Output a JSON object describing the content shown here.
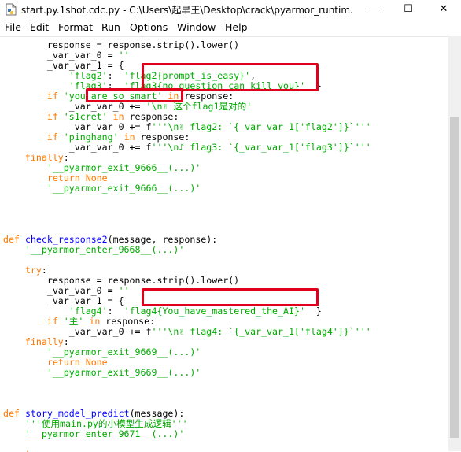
{
  "window": {
    "title": "start.py.1shot.cdc.py - C:\\Users\\起早王\\Desktop\\crack\\pyarmor_runtim...",
    "minimize": "—",
    "maximize": "☐",
    "close": "✕"
  },
  "menu": [
    "File",
    "Edit",
    "Format",
    "Run",
    "Options",
    "Window",
    "Help"
  ],
  "code": [
    [
      [
        "        response = response.strip().lower()",
        ""
      ]
    ],
    [
      [
        "        _var_var_0 = ",
        ""
      ],
      [
        "''",
        "str"
      ]
    ],
    [
      [
        "        _var_var_1 = {",
        ""
      ]
    ],
    [
      [
        "            ",
        ""
      ],
      [
        "'flag2'",
        "str"
      ],
      [
        ":  ",
        ""
      ],
      [
        "'flag2{prompt_is_easy}'",
        "str"
      ],
      [
        ",",
        ""
      ]
    ],
    [
      [
        "            ",
        ""
      ],
      [
        "'flag3'",
        "str"
      ],
      [
        ":  ",
        ""
      ],
      [
        "'flag3{no_question_can_kill_you}'",
        "str"
      ],
      [
        "  }",
        ""
      ]
    ],
    [
      [
        "        ",
        ""
      ],
      [
        "if",
        "kw"
      ],
      [
        " ",
        ""
      ],
      [
        "'you_are_so_smart'",
        "str"
      ],
      [
        " ",
        ""
      ],
      [
        "in",
        "kw"
      ],
      [
        " response:",
        ""
      ]
    ],
    [
      [
        "            _var_var_0 += ",
        ""
      ],
      [
        "'\\n✌ 这个flag1是对的'",
        "str"
      ]
    ],
    [
      [
        "        ",
        ""
      ],
      [
        "if",
        "kw"
      ],
      [
        " ",
        ""
      ],
      [
        "'s1cret'",
        "str"
      ],
      [
        " ",
        ""
      ],
      [
        "in",
        "kw"
      ],
      [
        " response:",
        ""
      ]
    ],
    [
      [
        "            _var_var_0 += f",
        ""
      ],
      [
        "'''\\n✌ flag2: `{_var_var_1['flag2']}`'''",
        "str"
      ]
    ],
    [
      [
        "        ",
        ""
      ],
      [
        "if",
        "kw"
      ],
      [
        " ",
        ""
      ],
      [
        "'pinghang'",
        "str"
      ],
      [
        " ",
        ""
      ],
      [
        "in",
        "kw"
      ],
      [
        " response:",
        ""
      ]
    ],
    [
      [
        "            _var_var_0 += f",
        ""
      ],
      [
        "'''\\n♪ flag3: `{_var_var_1['flag3']}`'''",
        "str"
      ]
    ],
    [
      [
        "    ",
        ""
      ],
      [
        "finally",
        "kw"
      ],
      [
        ":",
        ""
      ]
    ],
    [
      [
        "        ",
        ""
      ],
      [
        "'__pyarmor_exit_9666__(...)'",
        "str"
      ]
    ],
    [
      [
        "        ",
        ""
      ],
      [
        "return",
        "kw"
      ],
      [
        " ",
        ""
      ],
      [
        "None",
        "kw"
      ]
    ],
    [
      [
        "        ",
        ""
      ],
      [
        "'__pyarmor_exit_9666__(...)'",
        "str"
      ]
    ],
    [
      [
        "",
        ""
      ]
    ],
    [
      [
        "",
        ""
      ]
    ],
    [
      [
        "",
        ""
      ]
    ],
    [
      [
        "",
        ""
      ]
    ],
    [
      [
        "",
        ""
      ],
      [
        "def",
        "kw"
      ],
      [
        " ",
        ""
      ],
      [
        "check_response2",
        "def"
      ],
      [
        "(message, response):",
        ""
      ]
    ],
    [
      [
        "    ",
        ""
      ],
      [
        "'__pyarmor_enter_9668__(...)'",
        "str"
      ]
    ],
    [
      [
        "",
        ""
      ]
    ],
    [
      [
        "    ",
        ""
      ],
      [
        "try",
        "kw"
      ],
      [
        ":",
        ""
      ]
    ],
    [
      [
        "        response = response.strip().lower()",
        ""
      ]
    ],
    [
      [
        "        _var_var_0 = ",
        ""
      ],
      [
        "''",
        "str"
      ]
    ],
    [
      [
        "        _var_var_1 = {",
        ""
      ]
    ],
    [
      [
        "            ",
        ""
      ],
      [
        "'flag4'",
        "str"
      ],
      [
        ":  ",
        ""
      ],
      [
        "'flag4{You_have_mastered_the_AI}'",
        "str"
      ],
      [
        "  }",
        ""
      ]
    ],
    [
      [
        "        ",
        ""
      ],
      [
        "if",
        "kw"
      ],
      [
        " ",
        ""
      ],
      [
        "'主'",
        "str"
      ],
      [
        " ",
        ""
      ],
      [
        "in",
        "kw"
      ],
      [
        " response:",
        ""
      ]
    ],
    [
      [
        "            _var_var_0 += f",
        ""
      ],
      [
        "'''\\n✌ flag4: `{_var_var_1['flag4']}`'''",
        "str"
      ]
    ],
    [
      [
        "    ",
        ""
      ],
      [
        "finally",
        "kw"
      ],
      [
        ":",
        ""
      ]
    ],
    [
      [
        "        ",
        ""
      ],
      [
        "'__pyarmor_exit_9669__(...)'",
        "str"
      ]
    ],
    [
      [
        "        ",
        ""
      ],
      [
        "return",
        "kw"
      ],
      [
        " ",
        ""
      ],
      [
        "None",
        "kw"
      ]
    ],
    [
      [
        "        ",
        ""
      ],
      [
        "'__pyarmor_exit_9669__(...)'",
        "str"
      ]
    ],
    [
      [
        "",
        ""
      ]
    ],
    [
      [
        "",
        ""
      ]
    ],
    [
      [
        "",
        ""
      ]
    ],
    [
      [
        "",
        ""
      ],
      [
        "def",
        "kw"
      ],
      [
        " ",
        ""
      ],
      [
        "story_model_predict",
        "def"
      ],
      [
        "(message):",
        ""
      ]
    ],
    [
      [
        "    ",
        ""
      ],
      [
        "'''使用main.py的小模型生成逻辑'''",
        "str"
      ]
    ],
    [
      [
        "    ",
        ""
      ],
      [
        "'__pyarmor_enter_9671__(...)'",
        "str"
      ]
    ],
    [
      [
        "",
        ""
      ]
    ],
    [
      [
        "    ",
        ""
      ],
      [
        "try",
        "kw"
      ],
      [
        ":",
        ""
      ]
    ]
  ],
  "colors": {
    "keyword": "#ff7700",
    "string": "#00aa00",
    "definition": "#0000ff",
    "highlight_box": "#e0001b"
  }
}
